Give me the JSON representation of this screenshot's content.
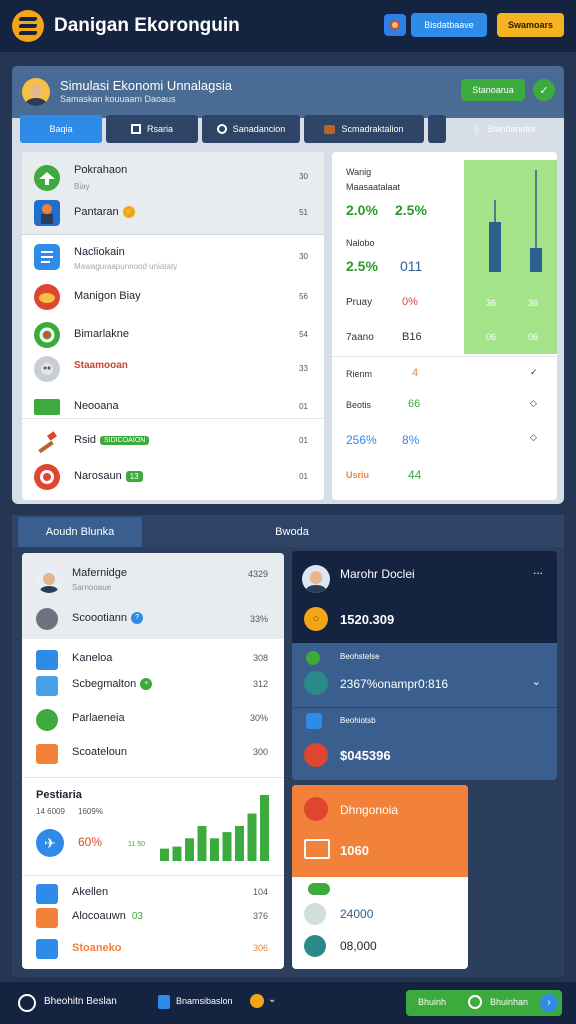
{
  "colors": {
    "accent": "#2f8be8",
    "brand": "#f2a516",
    "success": "#3caa3c",
    "orange": "#f2813a",
    "navy": "#142340"
  },
  "header": {
    "title": "Danigan Ekoronguin",
    "btn_blue": "Bisdatbaave",
    "btn_yellow": "Swamoars"
  },
  "panel": {
    "title": "Simulasi Ekonomi Unnalagsia",
    "subtitle": "Samaskan kouuaam Daoaus",
    "btn": "Stanoarua",
    "check": "✓"
  },
  "tabs": [
    {
      "label": "Baqia"
    },
    {
      "label": "Rsaria"
    },
    {
      "label": "Sanadancion"
    },
    {
      "label": "Scmadraktalion"
    },
    {
      "label": "Stanbanetor"
    }
  ],
  "list": [
    {
      "label": "Pokrahaon",
      "sub": "Biay",
      "value": "30",
      "icon": "plane-icon"
    },
    {
      "label": "Pantaran",
      "sub": "",
      "value": "51",
      "icon": "worker-icon",
      "badge": "○"
    },
    {
      "label": "Nacliokain",
      "sub": "Mawaguraapunnood uniataty",
      "value": "30",
      "icon": "document-icon"
    },
    {
      "label": "Manigon Biay",
      "sub": "",
      "value": "56",
      "icon": "handshake-icon"
    },
    {
      "label": "Bimarlakne",
      "sub": "",
      "value": "54",
      "icon": "gear-icon"
    },
    {
      "label": "Staamooan",
      "sub": "",
      "value": "33",
      "icon": "coins-icon"
    },
    {
      "label": "Neooana",
      "sub": "",
      "value": "01",
      "icon": "cash-icon"
    },
    {
      "label": "Rsid",
      "sub": "",
      "value": "01",
      "icon": "hammer-icon",
      "pill": "SIDICOAION"
    },
    {
      "label": "Narosaun",
      "sub": "",
      "value": "01",
      "icon": "target-icon",
      "pill": "13"
    }
  ],
  "stats": {
    "rows": [
      {
        "label": "Wanig",
        "sub": "Maasaatalaat"
      },
      {
        "label": "Nalobo"
      },
      {
        "label": "Pruay",
        "v1": "0%"
      },
      {
        "label": "7aano",
        "v1": "B16"
      }
    ],
    "big1": "2.0%",
    "big2": "2.5%",
    "big3": "2.5%",
    "big4": "011",
    "bar_vals": [
      "36",
      "36",
      "06",
      "06"
    ],
    "trend": [
      {
        "label": "Rienm",
        "v": "4"
      },
      {
        "label": "Beotis",
        "v": "66"
      },
      {
        "label": "256%",
        "v": "8%"
      },
      {
        "label": "Usriu",
        "v": "44"
      }
    ]
  },
  "sec2": {
    "tab1": "Aoudn Blunka",
    "tab2": "Bwoda"
  },
  "wlist": [
    {
      "label": "Mafernidge",
      "sub": "Sarnooaue",
      "value": "4329"
    },
    {
      "label": "Scoootiann",
      "value": "33%"
    },
    {
      "label": "Kaneloa",
      "value": "308"
    },
    {
      "label": "Scbegmalton",
      "value": "312"
    },
    {
      "label": "Parlaeneia",
      "value": "30%"
    },
    {
      "label": "Scoateloun",
      "value": "300"
    }
  ],
  "mini": {
    "title": "Pestiaria",
    "sub1": "14 6009",
    "sub2": "1609%",
    "pct": "60%",
    "tiny": "11 50",
    "bars": [
      12,
      14,
      22,
      34,
      22,
      28,
      34,
      46,
      64
    ]
  },
  "bottomlist": [
    {
      "label": "Akellen",
      "value": "104"
    },
    {
      "label": "Alocoauwn",
      "value": "376",
      "pill": "03"
    },
    {
      "label": "Stoaneko",
      "value": "306"
    }
  ],
  "dark": {
    "name": "Marohr Doclei",
    "dots": "...",
    "amount": "1520.309",
    "row1": "Beohstelse",
    "row2": "2367%onampr0:816",
    "row3": "Beohiotsb",
    "row4": "$045396"
  },
  "orange": {
    "title": "Dhngonoia",
    "amount": "1060",
    "v1": "24000",
    "v2": "08,000"
  },
  "bottom": {
    "left": "Bheohitn Beslan",
    "mid": "Bnamsibaslon",
    "right1": "Bhuinh",
    "right2": "Bhuinhan"
  }
}
